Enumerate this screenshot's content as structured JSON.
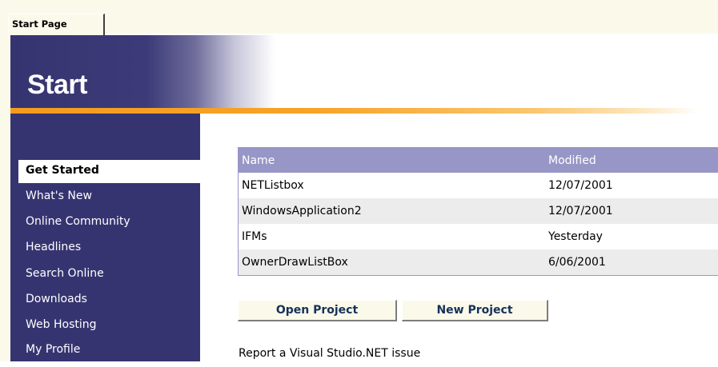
{
  "tab": {
    "label": "Start Page"
  },
  "header": {
    "title": "Start"
  },
  "sidebar": {
    "items": [
      {
        "label": "Get Started",
        "active": true
      },
      {
        "label": "What's New"
      },
      {
        "label": "Online Community"
      },
      {
        "label": "Headlines"
      },
      {
        "label": "Search Online"
      },
      {
        "label": "Downloads"
      },
      {
        "label": "Web Hosting"
      },
      {
        "label": "My Profile"
      }
    ]
  },
  "projects": {
    "columns": [
      "Name",
      "Modified"
    ],
    "rows": [
      [
        "NETListbox",
        "12/07/2001"
      ],
      [
        "WindowsApplication2",
        "12/07/2001"
      ],
      [
        "IFMs",
        "Yesterday"
      ],
      [
        "OwnerDrawListBox",
        "6/06/2001"
      ]
    ]
  },
  "buttons": {
    "open_project": "Open Project",
    "new_project": "New Project"
  },
  "report_link": "Report a Visual Studio.NET issue",
  "colors": {
    "sidebar": "#363470",
    "table_header": "#9896c6",
    "accent_rule": "#f59b1e",
    "tab_background": "#fbf9ea"
  }
}
